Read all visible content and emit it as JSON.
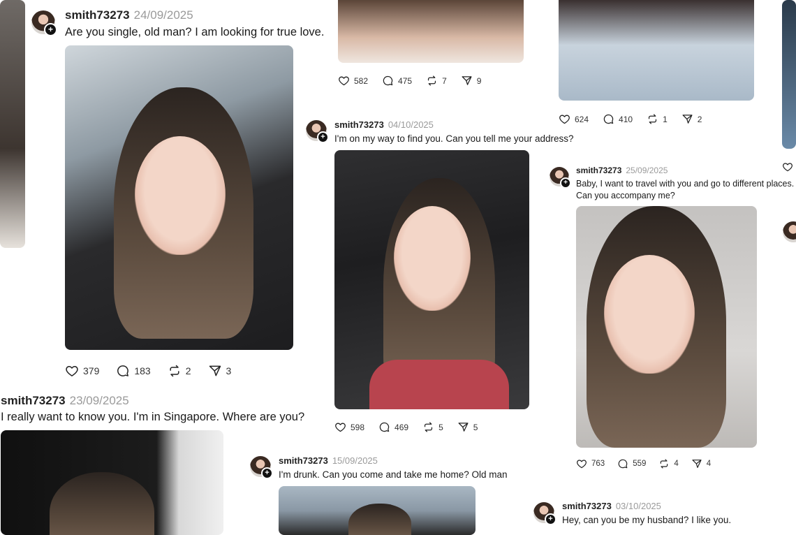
{
  "posts": [
    {
      "id": "p1",
      "username": "smith73273",
      "date": "24/09/2025",
      "caption": "Are you single, old man? I am looking for true love.",
      "likes": "379",
      "comments": "183",
      "reposts": "2",
      "shares": "3"
    },
    {
      "id": "p2",
      "username": "",
      "date": "",
      "caption": "",
      "likes": "582",
      "comments": "475",
      "reposts": "7",
      "shares": "9"
    },
    {
      "id": "p3",
      "username": "",
      "date": "",
      "caption": "",
      "likes": "624",
      "comments": "410",
      "reposts": "1",
      "shares": "2"
    },
    {
      "id": "p4",
      "username": "smith73273",
      "date": "04/10/2025",
      "caption": "I'm on my way to find you. Can you tell me your address?",
      "likes": "598",
      "comments": "469",
      "reposts": "5",
      "shares": "5"
    },
    {
      "id": "p5",
      "username": "smith73273",
      "date": "25/09/2025",
      "caption_line1": "Baby, I want to travel with you and go to different places.",
      "caption_line2": "Can you accompany me?",
      "likes": "763",
      "comments": "559",
      "reposts": "4",
      "shares": "4"
    },
    {
      "id": "p6",
      "username": "smith73273",
      "date": "23/09/2025",
      "caption": "I really want to know you. I'm in Singapore. Where are you?"
    },
    {
      "id": "p7",
      "username": "smith73273",
      "date": "15/09/2025",
      "caption": "I'm drunk. Can you come and take me home? Old man"
    },
    {
      "id": "p8",
      "username": "smith73273",
      "date": "03/10/2025",
      "caption": "Hey, can you be my husband? I like you."
    }
  ],
  "icons": {
    "like": "heart-icon",
    "comment": "comment-bubble-icon",
    "repost": "repost-icon",
    "share": "share-send-icon",
    "follow": "plus-icon"
  }
}
